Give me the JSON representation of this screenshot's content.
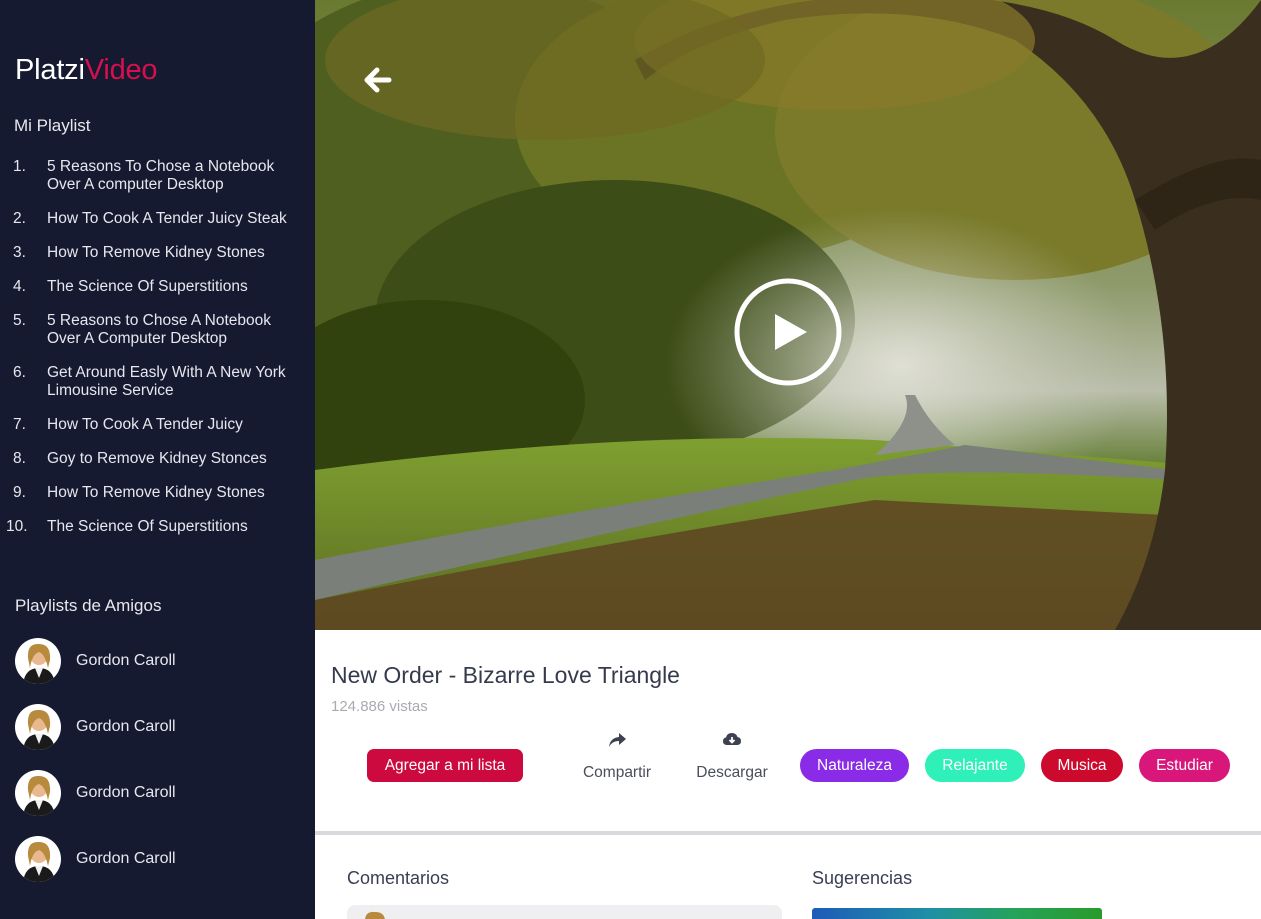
{
  "brand": {
    "part1": "Platzi",
    "part2": "Video"
  },
  "sidebar": {
    "playlist_title": "Mi Playlist",
    "playlist": [
      {
        "num": "1.",
        "title": "5 Reasons To Chose a Notebook Over A computer Desktop"
      },
      {
        "num": "2.",
        "title": "How To Cook A Tender Juicy Steak"
      },
      {
        "num": "3.",
        "title": "How To Remove Kidney Stones"
      },
      {
        "num": "4.",
        "title": "The Science Of Superstitions"
      },
      {
        "num": "5.",
        "title": "5 Reasons to Chose A Notebook Over A Computer Desktop"
      },
      {
        "num": "6.",
        "title": "Get Around Easly With A New York Limousine Service"
      },
      {
        "num": "7.",
        "title": "How To Cook A Tender Juicy"
      },
      {
        "num": "8.",
        "title": "Goy to Remove Kidney Stonces"
      },
      {
        "num": "9.",
        "title": "How To Remove Kidney Stones"
      },
      {
        "num": "10.",
        "title": "The Science Of Superstitions"
      }
    ],
    "friends_title": "Playlists de Amigos",
    "friends": [
      {
        "name": "Gordon Caroll"
      },
      {
        "name": "Gordon Caroll"
      },
      {
        "name": "Gordon Caroll"
      },
      {
        "name": "Gordon Caroll"
      }
    ]
  },
  "video": {
    "title": "New Order - Bizarre Love Triangle",
    "views": "124.886 vistas",
    "add_label": "Agregar a mi lista",
    "share_label": "Compartir",
    "download_label": "Descargar"
  },
  "tags": [
    {
      "label": "Naturaleza",
      "color": "#8a2be8"
    },
    {
      "label": "Relajante",
      "color": "#2ef0b8"
    },
    {
      "label": "Musica",
      "color": "#cc0a2e"
    },
    {
      "label": "Estudiar",
      "color": "#d9167a"
    }
  ],
  "sections": {
    "comments": "Comentarios",
    "suggestions": "Sugerencias"
  },
  "colors": {
    "sidebar_bg": "#161a30",
    "accent": "#d6104f"
  }
}
